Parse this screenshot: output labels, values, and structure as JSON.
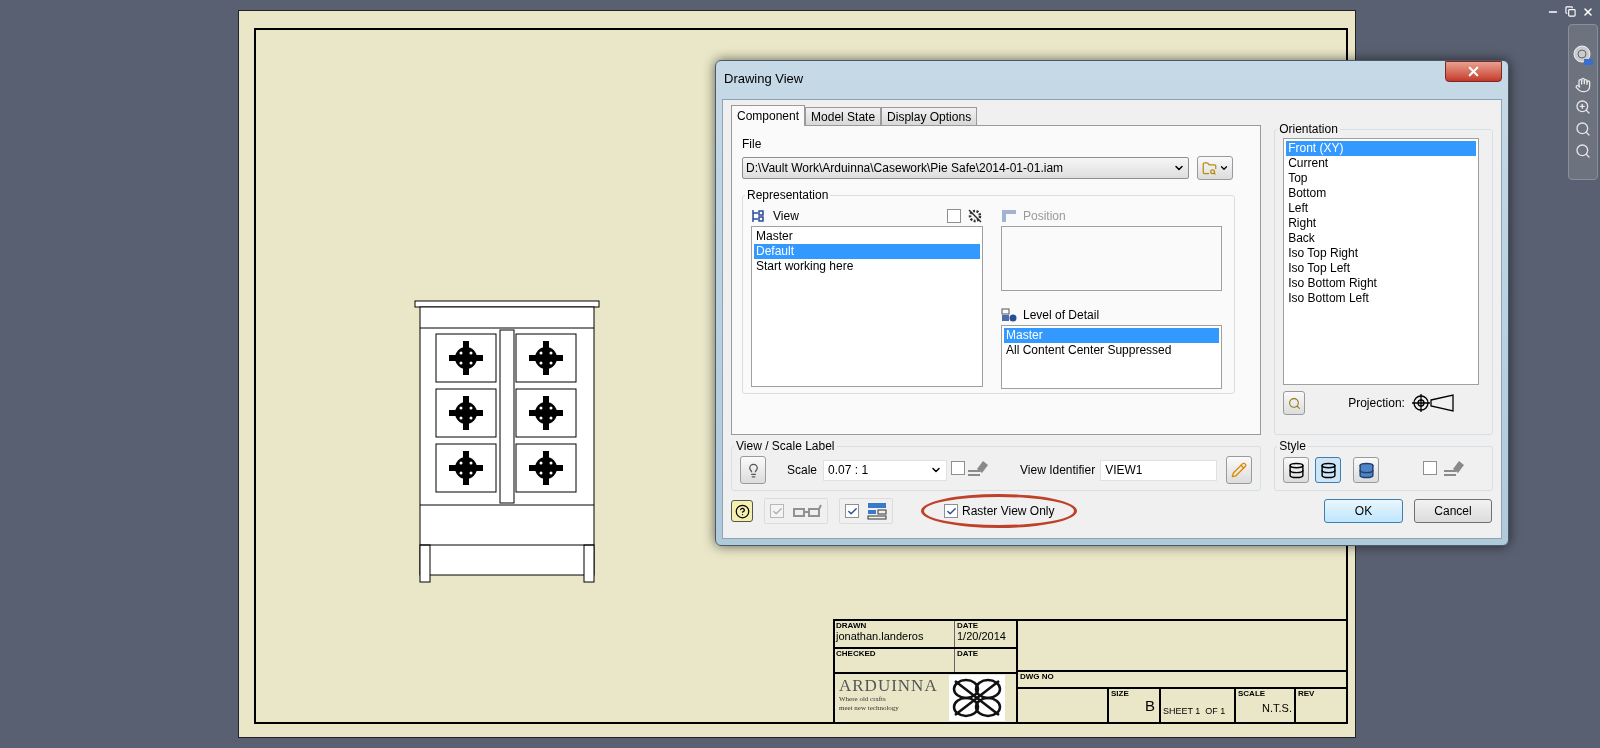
{
  "sheet": {
    "title_block": {
      "drawn_label": "DRAWN",
      "drawn_by": "jonathan.landeros",
      "drawn_date_label": "DATE",
      "drawn_date": "1/20/2014",
      "checked_label": "CHECKED",
      "checked_date_label": "DATE",
      "company": "ARDUINNA",
      "tagline": [
        "Where old crafts",
        "meet new technology"
      ],
      "dwg_no_label": "DWG NO",
      "size_label": "SIZE",
      "size": "B",
      "sheet": "SHEET 1  OF 1",
      "scale_label": "SCALE",
      "scale": "N.T.S.",
      "rev_label": "REV"
    }
  },
  "dialog": {
    "title": "Drawing View",
    "tabs": [
      {
        "label": "Component",
        "selected": true
      },
      {
        "label": "Model State",
        "selected": false
      },
      {
        "label": "Display Options",
        "selected": false
      }
    ],
    "file": {
      "label": "File",
      "value": "D:\\Vault Work\\Arduinna\\Casework\\Pie Safe\\2014-01-01.iam"
    },
    "representation": {
      "title": "Representation",
      "view": {
        "label": "View",
        "checked": false,
        "items": [
          {
            "label": "Master",
            "selected": false
          },
          {
            "label": "Default",
            "selected": true
          },
          {
            "label": "Start working here",
            "selected": false
          }
        ]
      },
      "position": {
        "label": "Position",
        "disabled": true
      },
      "level_of_detail": {
        "label": "Level of Detail",
        "items": [
          {
            "label": "Master",
            "selected": true
          },
          {
            "label": "All Content Center Suppressed",
            "selected": false
          }
        ]
      }
    },
    "orientation": {
      "title": "Orientation",
      "items": [
        {
          "label": "Front (XY)",
          "selected": true
        },
        {
          "label": "Current",
          "selected": false
        },
        {
          "label": "Top",
          "selected": false
        },
        {
          "label": "Bottom",
          "selected": false
        },
        {
          "label": "Left",
          "selected": false
        },
        {
          "label": "Right",
          "selected": false
        },
        {
          "label": "Back",
          "selected": false
        },
        {
          "label": "Iso Top Right",
          "selected": false
        },
        {
          "label": "Iso Top Left",
          "selected": false
        },
        {
          "label": "Iso Bottom Right",
          "selected": false
        },
        {
          "label": "Iso Bottom Left",
          "selected": false
        }
      ],
      "projection_label": "Projection:"
    },
    "view_scale_label": {
      "title": "View / Scale Label",
      "scale_label": "Scale",
      "scale": "0.07 : 1",
      "scale_label_checked": false,
      "view_identifier_label": "View Identifier",
      "view_identifier": "VIEW1"
    },
    "style": {
      "title": "Style",
      "options": [
        {
          "selected": false
        },
        {
          "selected": true
        },
        {
          "selected": false
        }
      ],
      "checked": false
    },
    "footer": {
      "toggles": [
        {
          "checked": true,
          "disabled": true
        },
        {
          "checked": true,
          "disabled": false
        }
      ],
      "raster": {
        "label": "Raster View Only",
        "checked": true,
        "highlighted": true
      },
      "buttons": [
        {
          "label": "OK",
          "default": true
        },
        {
          "label": "Cancel",
          "default": false
        }
      ]
    }
  }
}
